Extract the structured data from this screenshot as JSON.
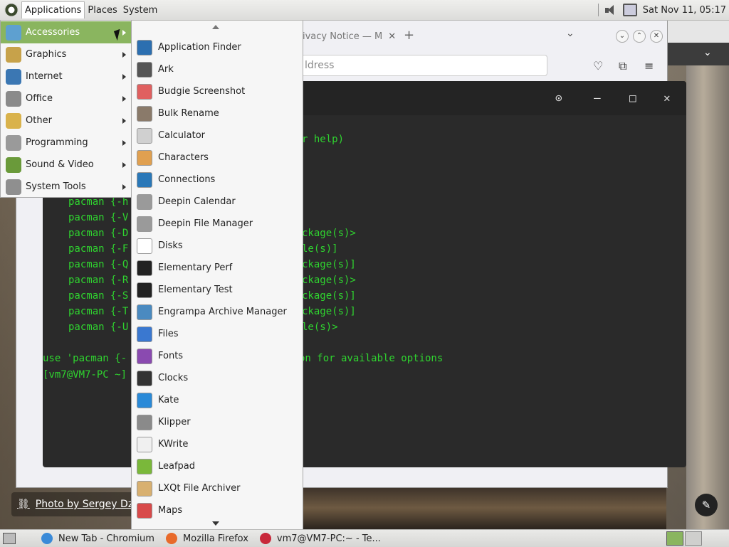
{
  "top_panel": {
    "menus": [
      "Applications",
      "Places",
      "System"
    ],
    "clock": "Sat Nov 11, 05:17"
  },
  "categories": [
    {
      "label": "Accessories",
      "icon": "accessories-icon",
      "color": "#5ea0d0",
      "active": true
    },
    {
      "label": "Graphics",
      "icon": "graphics-icon",
      "color": "#c7a24a"
    },
    {
      "label": "Internet",
      "icon": "internet-icon",
      "color": "#3b77b3"
    },
    {
      "label": "Office",
      "icon": "office-icon",
      "color": "#8a8a8a"
    },
    {
      "label": "Other",
      "icon": "other-icon",
      "color": "#d9b24b"
    },
    {
      "label": "Programming",
      "icon": "programming-icon",
      "color": "#9a9a9a"
    },
    {
      "label": "Sound & Video",
      "icon": "sound-video-icon",
      "color": "#6a9a3a"
    },
    {
      "label": "System Tools",
      "icon": "system-tools-icon",
      "color": "#8f8f8f"
    }
  ],
  "apps": [
    {
      "label": "Application Finder",
      "icon": "magnifier-icon",
      "color": "#2c6fb0"
    },
    {
      "label": "Ark",
      "icon": "ark-icon",
      "color": "#555555"
    },
    {
      "label": "Budgie Screenshot",
      "icon": "screenshot-icon",
      "color": "#e06060"
    },
    {
      "label": "Bulk Rename",
      "icon": "bulk-rename-icon",
      "color": "#8a7a6a"
    },
    {
      "label": "Calculator",
      "icon": "calculator-icon",
      "color": "#d0d0d0"
    },
    {
      "label": "Characters",
      "icon": "characters-icon",
      "color": "#e0a050"
    },
    {
      "label": "Connections",
      "icon": "connections-icon",
      "color": "#2a78b8"
    },
    {
      "label": "Deepin Calendar",
      "icon": "calendar-icon",
      "color": "#9a9a9a"
    },
    {
      "label": "Deepin File Manager",
      "icon": "file-manager-icon",
      "color": "#9a9a9a"
    },
    {
      "label": "Disks",
      "icon": "disks-icon",
      "color": "#ffffff"
    },
    {
      "label": "Elementary Perf",
      "icon": "perf-icon",
      "color": "#222222"
    },
    {
      "label": "Elementary Test",
      "icon": "test-icon",
      "color": "#222222"
    },
    {
      "label": "Engrampa Archive Manager",
      "icon": "archive-manager-icon",
      "color": "#4a8ac0"
    },
    {
      "label": "Files",
      "icon": "files-icon",
      "color": "#3a78d0"
    },
    {
      "label": "Fonts",
      "icon": "fonts-icon",
      "color": "#8a4ab0"
    },
    {
      "label": "Clocks",
      "icon": "clock-icon",
      "color": "#333333"
    },
    {
      "label": "Kate",
      "icon": "kate-icon",
      "color": "#2a8ad8"
    },
    {
      "label": "Klipper",
      "icon": "klipper-icon",
      "color": "#8a8a8a"
    },
    {
      "label": "KWrite",
      "icon": "kwrite-icon",
      "color": "#f0f0f0"
    },
    {
      "label": "Leafpad",
      "icon": "leafpad-icon",
      "color": "#7ab83a"
    },
    {
      "label": "LXQt File Archiver",
      "icon": "lxqt-archiver-icon",
      "color": "#d8b070"
    },
    {
      "label": "Maps",
      "icon": "maps-icon",
      "color": "#d84a4a"
    }
  ],
  "firefox": {
    "tab_title": "ivacy Notice — M",
    "url_placeholder": "ldress"
  },
  "terminal": {
    "help_text": "r help)",
    "lines": [
      "pacman {-h",
      "pacman {-V",
      "pacman {-D",
      "pacman {-F",
      "pacman {-Q",
      "pacman {-R",
      "pacman {-S",
      "pacman {-T",
      "pacman {-U"
    ],
    "tails": [
      "",
      "",
      "ckage(s)>",
      "le(s)]",
      "ckage(s)]",
      "ckage(s)>",
      "ckage(s)]",
      "ckage(s)]",
      "le(s)>"
    ],
    "usage": "use 'pacman {-",
    "usage_tail": "on for available options",
    "prompt": "[vm7@VM7-PC ~]"
  },
  "photo_credit": "Photo by Sergey Dzyuba",
  "taskbar": [
    {
      "label": "New Tab - Chromium",
      "icon": "chromium-icon",
      "color": "#3a8ad8"
    },
    {
      "label": "Mozilla Firefox",
      "icon": "firefox-icon",
      "color": "#e86a2a"
    },
    {
      "label": "vm7@VM7-PC:~ - Te...",
      "icon": "terminal-icon",
      "color": "#c8283a"
    }
  ]
}
